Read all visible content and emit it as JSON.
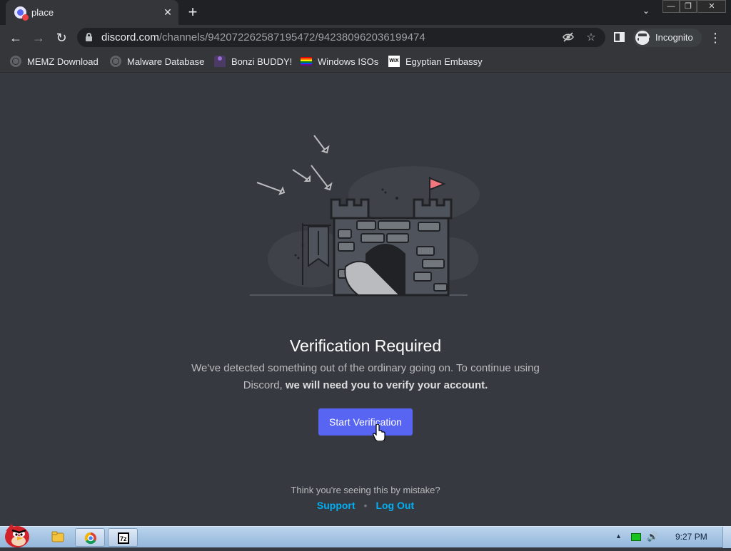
{
  "browser": {
    "tab": {
      "title": "place",
      "close": "✕"
    },
    "new_tab": "+",
    "tab_search": "⌄",
    "window_controls": {
      "minimize": "—",
      "restore": "❐",
      "close": "✕"
    },
    "nav": {
      "back": "←",
      "forward": "→",
      "reload": "↻"
    },
    "url": {
      "host": "discord.com",
      "path": "/channels/942072262587195472/942380962036199474"
    },
    "omnibox_icons": [
      "eye-off-icon",
      "star-icon"
    ],
    "incognito_label": "Incognito",
    "menu": "⋮",
    "bookmarks": [
      {
        "label": "MEMZ Download",
        "icon": "globe-icon"
      },
      {
        "label": "Malware Database",
        "icon": "globe-icon"
      },
      {
        "label": "Bonzi BUDDY!",
        "icon": "bonzi-icon"
      },
      {
        "label": "Windows ISOs",
        "icon": "rainbow-flag-icon"
      },
      {
        "label": "Egyptian Embassy",
        "icon": "wix-icon",
        "icon_text": "WiX"
      }
    ]
  },
  "page": {
    "title": "Verification Required",
    "description_line1": "We've detected something out of the ordinary going on. To continue using",
    "description_line2_start": "Discord, ",
    "description_line2_bold": "we will need you to verify your account.",
    "button_label": "Start Verification",
    "mistake_text": "Think you're seeing this by mistake?",
    "support_link": "Support",
    "separator": "•",
    "logout_link": "Log Out"
  },
  "taskbar": {
    "clock": "9:27 PM",
    "tray_arrow": "▲",
    "volume": "🔊"
  },
  "colors": {
    "page_bg": "#36393f",
    "blurple": "#5865f2",
    "link": "#00aff4",
    "flag": "#f2767e"
  }
}
